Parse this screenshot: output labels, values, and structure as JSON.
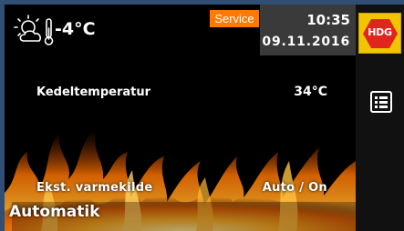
{
  "header": {
    "weather_icon": "sun-cloud-thermometer-icon",
    "outdoor_temperature": "-4°C",
    "service_label": "Service",
    "time": "10:35",
    "date": "09.11.2016"
  },
  "sidebar": {
    "logo_text": "HDG",
    "logo_color": "#f2c500",
    "menu_icon": "list-menu-icon"
  },
  "main": {
    "rows": [
      {
        "label": "Kedeltemperatur",
        "value": "34°C"
      },
      {
        "label": "Ekst.  varmekilde",
        "value": "Auto  /  On"
      }
    ],
    "mode": "Automatik"
  },
  "colors": {
    "service_badge": "#ff7a00",
    "frame": "#2f4f76",
    "datetime_bg": "#3a3a3a"
  }
}
